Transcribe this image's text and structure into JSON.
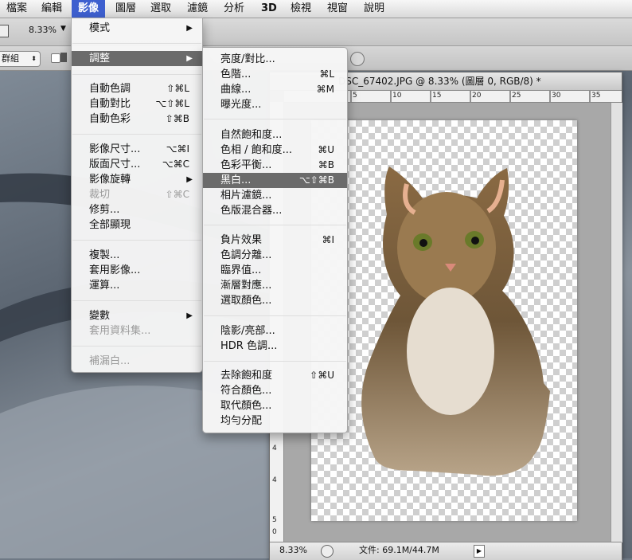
{
  "menubar": {
    "items": [
      "檔案",
      "編輯",
      "影像",
      "圖層",
      "選取",
      "濾鏡",
      "分析",
      "3D",
      "檢視",
      "視窗",
      "說明"
    ],
    "active_index": 2
  },
  "optionsbar": {
    "zoom": "8.33%",
    "group_select": "群組"
  },
  "document": {
    "title": "DSC_67402.JPG @ 8.33% (圖層 0, RGB/8) *",
    "ruler_h_labels": [
      "5",
      "10",
      "15",
      "20",
      "25",
      "30",
      "35"
    ],
    "ruler_v_labels": [
      "4",
      "4",
      "5",
      "0"
    ],
    "status_zoom": "8.33%",
    "status_file": "文件: 69.1M/44.7M"
  },
  "image_menu": {
    "items": [
      {
        "label": "模式",
        "shortcut": "",
        "submenu": true,
        "disabled": false,
        "highlight": false
      },
      {
        "label": "調整",
        "shortcut": "",
        "submenu": true,
        "disabled": false,
        "highlight": true
      },
      {
        "label": "自動色調",
        "shortcut": "⇧⌘L",
        "submenu": false,
        "disabled": false,
        "highlight": false
      },
      {
        "label": "自動對比",
        "shortcut": "⌥⇧⌘L",
        "submenu": false,
        "disabled": false,
        "highlight": false
      },
      {
        "label": "自動色彩",
        "shortcut": "⇧⌘B",
        "submenu": false,
        "disabled": false,
        "highlight": false
      },
      {
        "label": "影像尺寸...",
        "shortcut": "⌥⌘I",
        "submenu": false,
        "disabled": false,
        "highlight": false
      },
      {
        "label": "版面尺寸...",
        "shortcut": "⌥⌘C",
        "submenu": false,
        "disabled": false,
        "highlight": false
      },
      {
        "label": "影像旋轉",
        "shortcut": "",
        "submenu": true,
        "disabled": false,
        "highlight": false
      },
      {
        "label": "裁切",
        "shortcut": "⇧⌘C",
        "submenu": false,
        "disabled": true,
        "highlight": false
      },
      {
        "label": "修剪...",
        "shortcut": "",
        "submenu": false,
        "disabled": false,
        "highlight": false
      },
      {
        "label": "全部顯現",
        "shortcut": "",
        "submenu": false,
        "disabled": false,
        "highlight": false
      },
      {
        "label": "複製...",
        "shortcut": "",
        "submenu": false,
        "disabled": false,
        "highlight": false
      },
      {
        "label": "套用影像...",
        "shortcut": "",
        "submenu": false,
        "disabled": false,
        "highlight": false
      },
      {
        "label": "運算...",
        "shortcut": "",
        "submenu": false,
        "disabled": false,
        "highlight": false
      },
      {
        "label": "變數",
        "shortcut": "",
        "submenu": true,
        "disabled": false,
        "highlight": false
      },
      {
        "label": "套用資料集...",
        "shortcut": "",
        "submenu": false,
        "disabled": true,
        "highlight": false
      },
      {
        "label": "補漏白...",
        "shortcut": "",
        "submenu": false,
        "disabled": true,
        "highlight": false
      }
    ]
  },
  "adjust_menu": {
    "items": [
      {
        "label": "亮度/對比...",
        "shortcut": "",
        "highlight": false
      },
      {
        "label": "色階...",
        "shortcut": "⌘L",
        "highlight": false
      },
      {
        "label": "曲線...",
        "shortcut": "⌘M",
        "highlight": false
      },
      {
        "label": "曝光度...",
        "shortcut": "",
        "highlight": false
      },
      {
        "label": "自然飽和度...",
        "shortcut": "",
        "highlight": false
      },
      {
        "label": "色相 / 飽和度...",
        "shortcut": "⌘U",
        "highlight": false
      },
      {
        "label": "色彩平衡...",
        "shortcut": "⌘B",
        "highlight": false
      },
      {
        "label": "黑白...",
        "shortcut": "⌥⇧⌘B",
        "highlight": true
      },
      {
        "label": "相片濾鏡...",
        "shortcut": "",
        "highlight": false
      },
      {
        "label": "色版混合器...",
        "shortcut": "",
        "highlight": false
      },
      {
        "label": "負片效果",
        "shortcut": "⌘I",
        "highlight": false
      },
      {
        "label": "色調分離...",
        "shortcut": "",
        "highlight": false
      },
      {
        "label": "臨界值...",
        "shortcut": "",
        "highlight": false
      },
      {
        "label": "漸層對應...",
        "shortcut": "",
        "highlight": false
      },
      {
        "label": "選取顏色...",
        "shortcut": "",
        "highlight": false
      },
      {
        "label": "陰影/亮部...",
        "shortcut": "",
        "highlight": false
      },
      {
        "label": "HDR 色調...",
        "shortcut": "",
        "highlight": false
      },
      {
        "label": "去除飽和度",
        "shortcut": "⇧⌘U",
        "highlight": false
      },
      {
        "label": "符合顏色...",
        "shortcut": "",
        "highlight": false
      },
      {
        "label": "取代顏色...",
        "shortcut": "",
        "highlight": false
      },
      {
        "label": "均勻分配",
        "shortcut": "",
        "highlight": false
      }
    ]
  }
}
